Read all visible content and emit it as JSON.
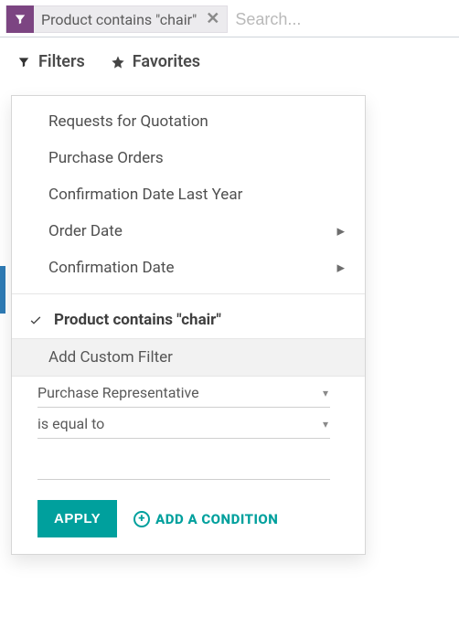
{
  "search": {
    "chip_label": "Product contains \"chair\"",
    "placeholder": "Search..."
  },
  "toolbar": {
    "filters_label": "Filters",
    "favorites_label": "Favorites"
  },
  "dropdown": {
    "items": [
      {
        "label": "Requests for Quotation",
        "has_submenu": false
      },
      {
        "label": "Purchase Orders",
        "has_submenu": false
      },
      {
        "label": "Confirmation Date Last Year",
        "has_submenu": false
      },
      {
        "label": "Order Date",
        "has_submenu": true
      },
      {
        "label": "Confirmation Date",
        "has_submenu": true
      }
    ],
    "active_filter_label": "Product contains \"chair\"",
    "add_custom_filter_label": "Add Custom Filter",
    "custom": {
      "field_select": "Purchase Representative",
      "operator_select": "is equal to",
      "value": ""
    },
    "apply_label": "APPLY",
    "add_condition_label": "ADD A CONDITION"
  }
}
